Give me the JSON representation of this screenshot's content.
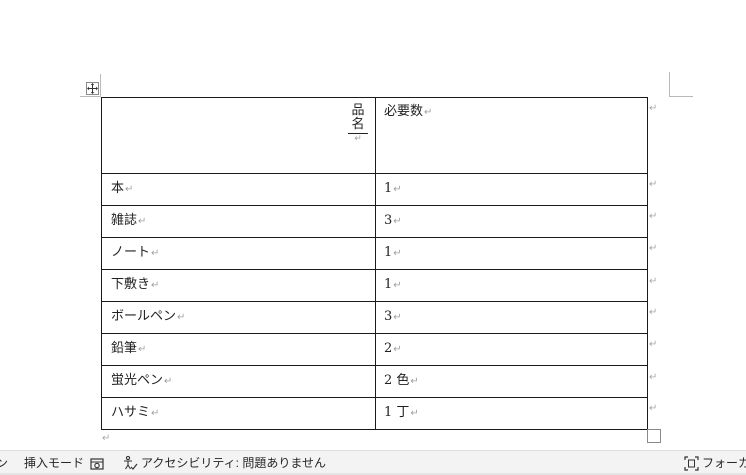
{
  "table": {
    "header": {
      "col1_vertical_chars": [
        "品",
        "名"
      ],
      "col2": "必要数"
    },
    "rows": [
      {
        "item": "本",
        "qty": "1"
      },
      {
        "item": "雑誌",
        "qty": "3"
      },
      {
        "item": "ノート",
        "qty": "1"
      },
      {
        "item": "下敷き",
        "qty": "1"
      },
      {
        "item": "ボールペン",
        "qty": "3"
      },
      {
        "item": "鉛筆",
        "qty": "2"
      },
      {
        "item": "蛍光ペン",
        "qty": "2 色"
      },
      {
        "item": "ハサミ",
        "qty": "1 丁"
      }
    ],
    "paragraph_mark": "↵"
  },
  "status_bar": {
    "left_fragment": "ン",
    "insert_mode": "挿入モード",
    "accessibility": "アクセシビリティ: 問題ありません",
    "focus": "フォーカス"
  }
}
